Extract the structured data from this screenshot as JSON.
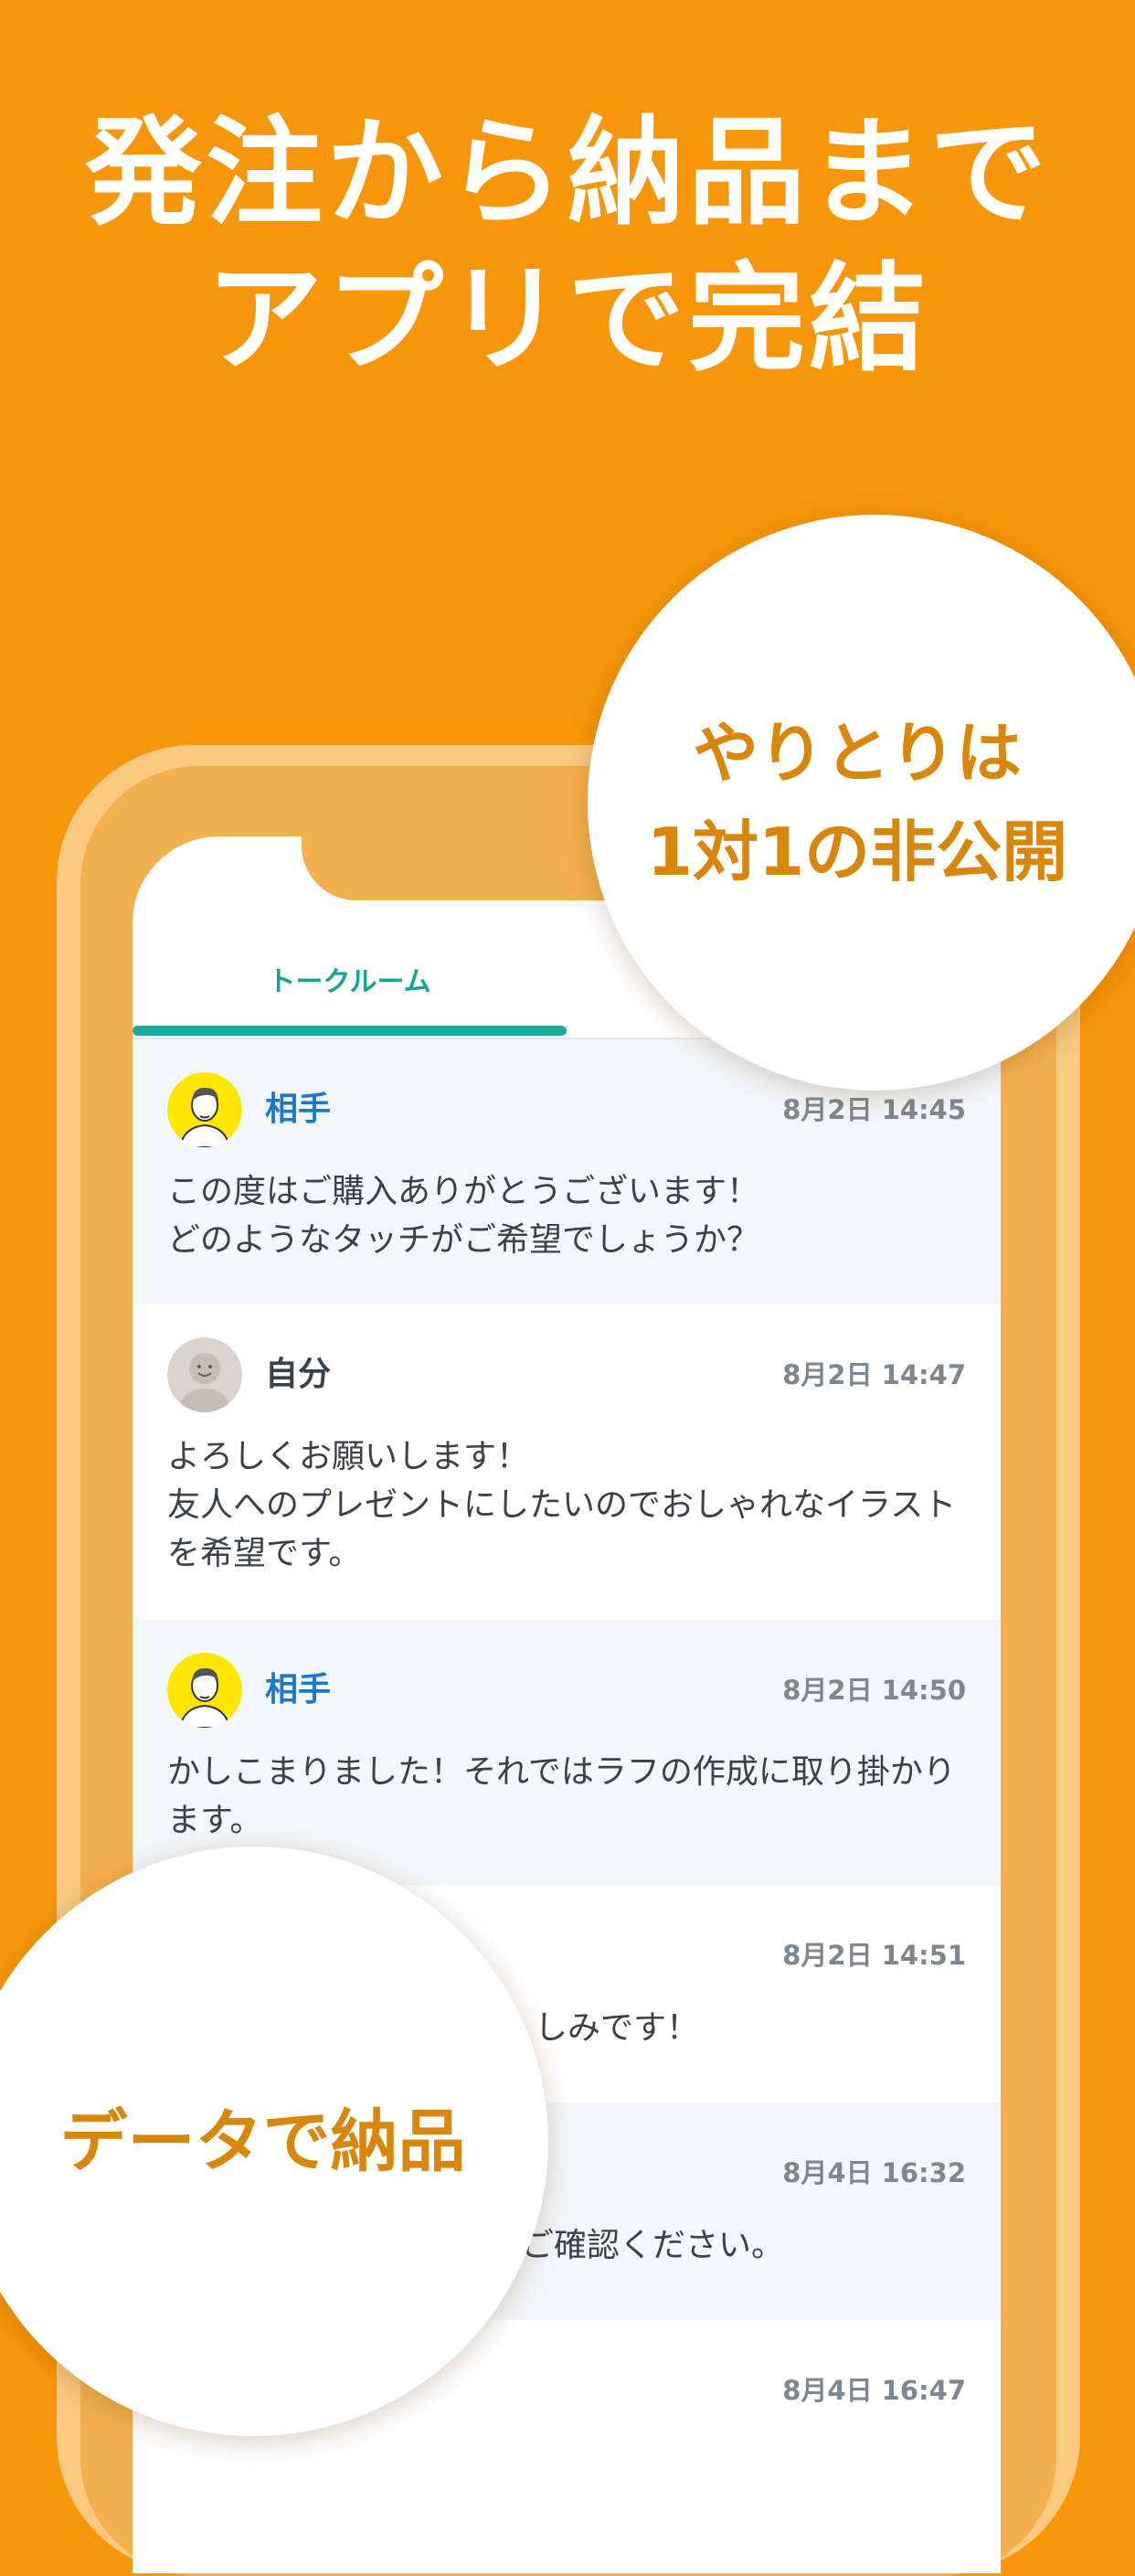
{
  "headline": {
    "line1": "発注から納品まで",
    "line2": "アプリで完結"
  },
  "tab": {
    "label": "トークルーム"
  },
  "messages": [
    {
      "sender": "相手",
      "role": "partner",
      "time": "8月2日 14:45",
      "text": "この度はご購入ありがとうございます！\nどのようなタッチがご希望でしょうか？"
    },
    {
      "sender": "自分",
      "role": "me",
      "time": "8月2日 14:47",
      "text": "よろしくお願いします！\n友人へのプレゼントにしたいのでおしゃれなイラストを希望です。"
    },
    {
      "sender": "相手",
      "role": "partner",
      "time": "8月2日 14:50",
      "text": "かしこまりました！それではラフの作成に取り掛かります。"
    },
    {
      "sender": "",
      "role": "me",
      "time": "8月2日 14:51",
      "text": "しみです！"
    },
    {
      "sender": "",
      "role": "partner",
      "time": "8月4日 16:32",
      "text": "ご確認ください。"
    },
    {
      "sender": "",
      "role": "me",
      "time": "8月4日 16:47",
      "text": ""
    }
  ],
  "badges": {
    "top_line1": "やりとりは",
    "top_line2": "1対1の非公開",
    "bottom": "データで納品"
  },
  "colors": {
    "background": "#F7960A",
    "accent_teal": "#1FA99A",
    "partner_name": "#1B78C8",
    "badge_text": "#D9860C"
  },
  "icons": {
    "partner_avatar": "man-on-yellow-avatar",
    "me_avatar": "smiley-person-avatar"
  }
}
